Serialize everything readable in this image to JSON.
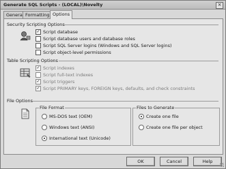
{
  "window": {
    "title": "Generate SQL Scripts - (LOCAL)\\Novelty",
    "close_glyph": "×"
  },
  "tabs": [
    {
      "label": "General",
      "active": false
    },
    {
      "label": "Formatting",
      "active": false
    },
    {
      "label": "Options",
      "active": true
    }
  ],
  "security": {
    "heading": "Security Scripting Options",
    "items": [
      {
        "label": "Script database",
        "checked": true
      },
      {
        "label": "Script database users and database roles",
        "checked": false
      },
      {
        "label": "Script SQL Server logins (Windows and SQL Server logins)",
        "checked": false
      },
      {
        "label": "Script object-level permissions",
        "checked": false
      }
    ]
  },
  "table": {
    "heading": "Table Scripting Options",
    "items": [
      {
        "label": "Script indexes",
        "checked": true
      },
      {
        "label": "Script full-text indexes",
        "checked": false
      },
      {
        "label": "Script triggers",
        "checked": true
      },
      {
        "label": "Script PRIMARY keys, FOREIGN keys, defaults, and check constraints",
        "checked": true
      }
    ]
  },
  "file": {
    "heading": "File Options",
    "format": {
      "title": "File Format",
      "options": [
        {
          "label": "MS-DOS text (OEM)",
          "selected": false
        },
        {
          "label": "Windows text (ANSI)",
          "selected": false
        },
        {
          "label": "International text (Unicode)",
          "selected": true
        }
      ]
    },
    "generate": {
      "title": "Files to Generate",
      "options": [
        {
          "label": "Create one file",
          "selected": true
        },
        {
          "label": "Create one file per object",
          "selected": false
        }
      ]
    }
  },
  "buttons": {
    "ok": "OK",
    "cancel": "Cancel",
    "help": "Help"
  },
  "check_glyph": "✓"
}
